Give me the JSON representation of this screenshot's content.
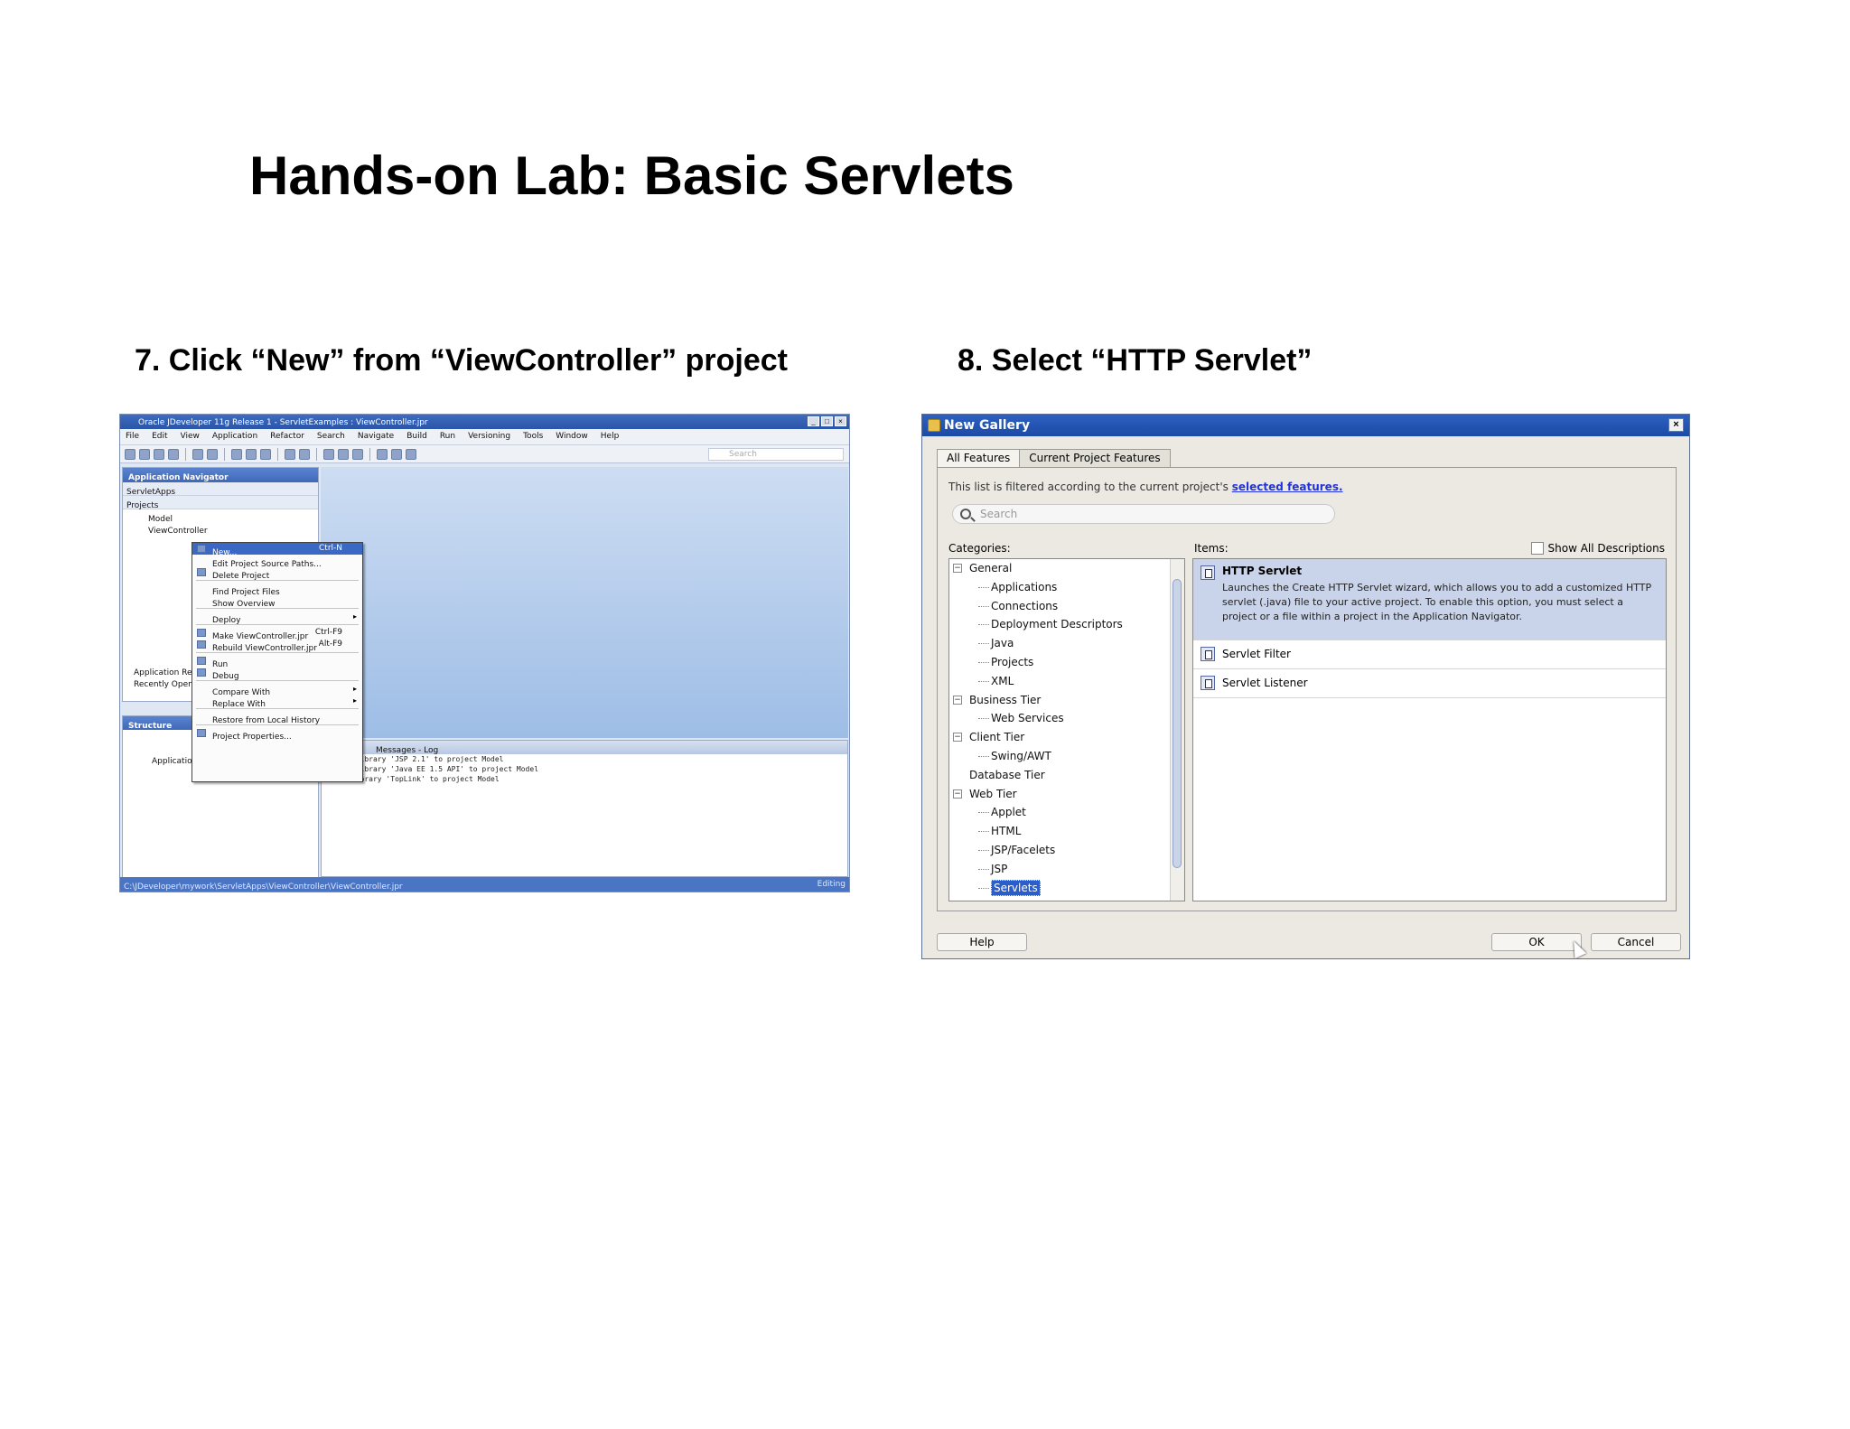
{
  "slide": {
    "title": "Hands-on Lab: Basic Servlets",
    "step7": "7. Click “New” from “ViewController” project",
    "step8": "8. Select “HTTP Servlet”"
  },
  "ide": {
    "title": "Oracle JDeveloper 11g Release 1 - ServletExamples : ViewController.jpr",
    "menu": [
      "File",
      "Edit",
      "View",
      "Application",
      "Refactor",
      "Search",
      "Navigate",
      "Build",
      "Run",
      "Versioning",
      "Tools",
      "Window",
      "Help"
    ],
    "search_placeholder": "Search",
    "nav_title": "Application Navigator",
    "app_selector": "ServletApps",
    "projects_label": "Projects",
    "tree": [
      "Model",
      "ViewController"
    ],
    "lower_nav": [
      "Application Resources",
      "Recently Opened Files"
    ],
    "structure_title": "Structure",
    "structure_item": "Application",
    "log_title": "Messages - Log",
    "log_lines": [
      "Adding library 'JSP 2.1' to project Model",
      "Adding library 'Java EE 1.5 API' to project Model",
      "Added library 'TopLink' to project Model"
    ],
    "status_left": "C:\\JDeveloper\\mywork\\ServletApps\\ViewController\\ViewController.jpr",
    "status_right": "Editing",
    "context_menu": [
      {
        "label": "New...",
        "shortcut": "Ctrl-N",
        "highlighted": true
      },
      {
        "label": "Edit Project Source Paths..."
      },
      {
        "label": "Delete Project"
      },
      {
        "sep": true
      },
      {
        "label": "Find Project Files"
      },
      {
        "label": "Show Overview"
      },
      {
        "sep": true
      },
      {
        "label": "Deploy",
        "submenu": true
      },
      {
        "sep": true
      },
      {
        "label": "Make ViewController.jpr",
        "shortcut": "Ctrl-F9"
      },
      {
        "label": "Rebuild ViewController.jpr",
        "shortcut": "Alt-F9"
      },
      {
        "sep": true
      },
      {
        "label": "Run"
      },
      {
        "label": "Debug"
      },
      {
        "sep": true
      },
      {
        "label": "Compare With",
        "submenu": true
      },
      {
        "label": "Replace With",
        "submenu": true
      },
      {
        "sep": true
      },
      {
        "label": "Restore from Local History"
      },
      {
        "sep": true
      },
      {
        "label": "Project Properties..."
      }
    ]
  },
  "gallery": {
    "title": "New Gallery",
    "close": "×",
    "tabs": [
      "All Features",
      "Current Project Features"
    ],
    "filter_text": "This list is filtered according to the current project's ",
    "filter_link": "selected features.",
    "search_placeholder": "Search",
    "categories_label": "Categories:",
    "items_label": "Items:",
    "show_all": "Show All Descriptions",
    "categories": [
      {
        "label": "General",
        "level": 0,
        "expanded": true
      },
      {
        "label": "Applications",
        "level": 1
      },
      {
        "label": "Connections",
        "level": 1
      },
      {
        "label": "Deployment Descriptors",
        "level": 1
      },
      {
        "label": "Java",
        "level": 1
      },
      {
        "label": "Projects",
        "level": 1
      },
      {
        "label": "XML",
        "level": 1
      },
      {
        "label": "Business Tier",
        "level": 0,
        "expanded": true
      },
      {
        "label": "Web Services",
        "level": 1
      },
      {
        "label": "Client Tier",
        "level": 0,
        "expanded": true
      },
      {
        "label": "Swing/AWT",
        "level": 1
      },
      {
        "label": "Database Tier",
        "level": 0
      },
      {
        "label": "Web Tier",
        "level": 0,
        "expanded": true
      },
      {
        "label": "Applet",
        "level": 1
      },
      {
        "label": "HTML",
        "level": 1
      },
      {
        "label": "JSP/Facelets",
        "level": 1
      },
      {
        "label": "JSP",
        "level": 1
      },
      {
        "label": "Servlets",
        "level": 1,
        "selected": true
      }
    ],
    "items": [
      {
        "name": "HTTP Servlet",
        "selected": true,
        "desc": "Launches the Create HTTP Servlet wizard, which allows you to add a customized HTTP servlet (.java) file to your active project. To enable this option, you must select a project or a file within a project in the Application Navigator."
      },
      {
        "name": "Servlet Filter"
      },
      {
        "name": "Servlet Listener"
      }
    ],
    "btn_help": "Help",
    "btn_ok": "OK",
    "btn_cancel": "Cancel"
  }
}
